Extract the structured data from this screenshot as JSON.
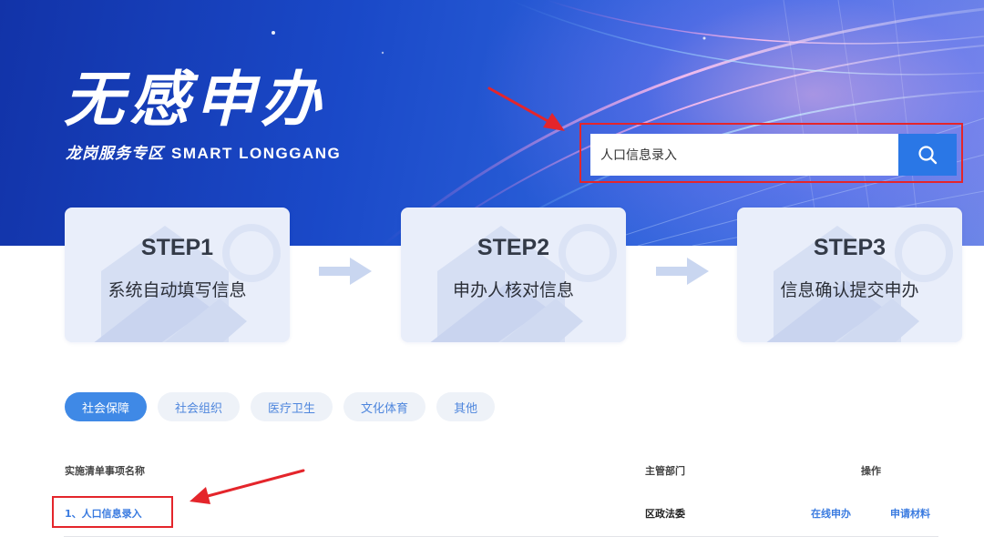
{
  "hero": {
    "title": "无感申办",
    "subtitle_cn": "龙岗服务专区",
    "subtitle_en": "SMART LONGGANG"
  },
  "search": {
    "value": "人口信息录入",
    "button_icon": "search-icon"
  },
  "steps": [
    {
      "num": "STEP1",
      "desc": "系统自动填写信息"
    },
    {
      "num": "STEP2",
      "desc": "申办人核对信息"
    },
    {
      "num": "STEP3",
      "desc": "信息确认提交申办"
    }
  ],
  "tabs": [
    {
      "label": "社会保障",
      "active": true
    },
    {
      "label": "社会组织",
      "active": false
    },
    {
      "label": "医疗卫生",
      "active": false
    },
    {
      "label": "文化体育",
      "active": false
    },
    {
      "label": "其他",
      "active": false
    }
  ],
  "table": {
    "headers": {
      "name": "实施清单事项名称",
      "dept": "主管部门",
      "ops": "操作"
    },
    "rows": [
      {
        "name": "1、人口信息录入",
        "dept": "区政法委",
        "op_online": "在线申办",
        "op_materials": "申请材料"
      }
    ]
  },
  "colors": {
    "accent": "#3f89e6",
    "highlight_red": "#e4252b",
    "link": "#3a7be0"
  }
}
